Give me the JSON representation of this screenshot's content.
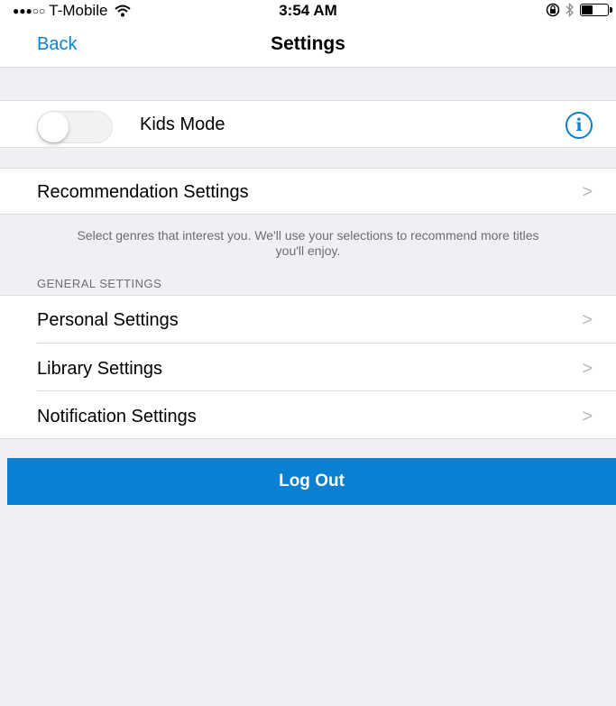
{
  "status_bar": {
    "signal_dots": "●●●○○",
    "carrier": "T-Mobile",
    "time": "3:54 AM"
  },
  "nav": {
    "back_label": "Back",
    "title": "Settings"
  },
  "kids_mode": {
    "label": "Kids Mode",
    "enabled": false
  },
  "recommendation": {
    "label": "Recommendation Settings",
    "footer": "Select genres that interest you. We'll use your selections to recommend more titles you'll enjoy."
  },
  "general": {
    "header": "GENERAL SETTINGS",
    "items": [
      {
        "label": "Personal Settings"
      },
      {
        "label": "Library Settings"
      },
      {
        "label": "Notification Settings"
      }
    ]
  },
  "logout_label": "Log Out",
  "chevron": ">",
  "colors": {
    "accent": "#0b7fd1",
    "group_background": "#efeff4"
  }
}
